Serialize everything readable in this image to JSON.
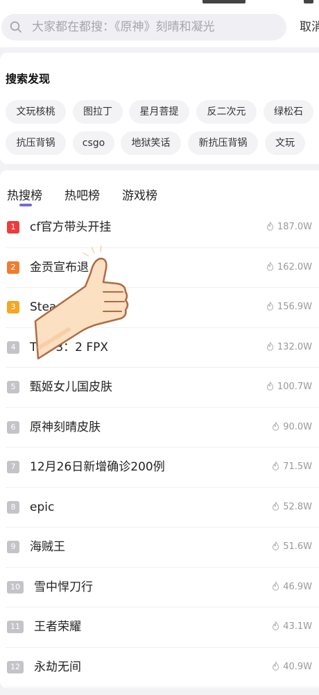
{
  "search": {
    "placeholder": "大家都在都搜：《原神》刻晴和凝光",
    "cancel_label": "取消"
  },
  "discover": {
    "title": "搜索发现",
    "chips": [
      "文玩核桃",
      "图拉丁",
      "星月菩提",
      "反二次元",
      "绿松石",
      "抗压背锅",
      "csgo",
      "地狱笑话",
      "新抗压背锅",
      "文玩"
    ]
  },
  "tabs": [
    {
      "label": "热搜榜",
      "active": true
    },
    {
      "label": "热吧榜",
      "active": false
    },
    {
      "label": "游戏榜",
      "active": false
    }
  ],
  "hot_list": [
    {
      "rank": "1",
      "title": "cf官方带头开挂",
      "heat": "187.0W"
    },
    {
      "rank": "2",
      "title": "金贡宣布退",
      "heat": "162.0W"
    },
    {
      "rank": "3",
      "title": "Stea",
      "heat": "156.9W"
    },
    {
      "rank": "4",
      "title": "TES 3：2 FPX",
      "heat": "132.0W"
    },
    {
      "rank": "5",
      "title": "甄姬女儿国皮肤",
      "heat": "100.7W"
    },
    {
      "rank": "6",
      "title": "原神刻晴皮肤",
      "heat": "90.0W"
    },
    {
      "rank": "7",
      "title": "12月26日新增确诊200例",
      "heat": "71.5W"
    },
    {
      "rank": "8",
      "title": "epic",
      "heat": "52.8W"
    },
    {
      "rank": "9",
      "title": "海贼王",
      "heat": "51.6W"
    },
    {
      "rank": "10",
      "title": "雪中悍刀行",
      "heat": "46.9W"
    },
    {
      "rank": "11",
      "title": "王者荣耀",
      "heat": "43.1W"
    },
    {
      "rank": "12",
      "title": "永劫无间",
      "heat": "40.9W"
    }
  ],
  "colors": {
    "rank_1": "#ee3b3b",
    "rank_2": "#f07d2e",
    "rank_3": "#f5a623",
    "rank_other": "#c4c4c8",
    "tab_accent": "#7b67d8"
  },
  "overlay_sticker": "thumbs-up-hand-icon"
}
